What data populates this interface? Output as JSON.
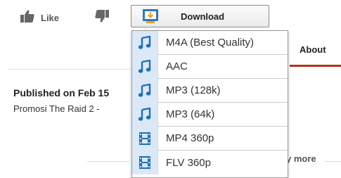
{
  "actions": {
    "like_label": "Like",
    "download_label": "Download"
  },
  "tabs": {
    "about_label": "About"
  },
  "video": {
    "published": "Published on Feb 15",
    "description": "Promosi The Raid 2 -"
  },
  "show_more": "y more",
  "download_menu": {
    "items": [
      {
        "label": "M4A (Best Quality)",
        "icon": "music-note-icon"
      },
      {
        "label": "AAC",
        "icon": "music-note-icon"
      },
      {
        "label": "MP3 (128k)",
        "icon": "music-note-icon"
      },
      {
        "label": "MP3 (64k)",
        "icon": "music-note-icon"
      },
      {
        "label": "MP4 360p",
        "icon": "film-strip-icon"
      },
      {
        "label": "FLV 360p",
        "icon": "film-strip-icon"
      }
    ]
  },
  "colors": {
    "accent_underline": "#b0341f",
    "icon_blue": "#1e6fb8",
    "icon_bg": "#dbe8f7"
  }
}
